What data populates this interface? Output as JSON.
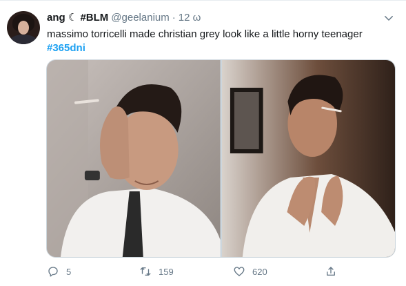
{
  "tweet": {
    "author": {
      "display_name": "ang ☾ #BLM",
      "handle": "@geelanium",
      "separator": "·",
      "time": "12 ω"
    },
    "text": "massimo torricelli made christian grey look like a little horny teenager",
    "hashtag": "#365dni",
    "media": {
      "count": 2,
      "subjects": [
        "man-smoking-hand-on-face",
        "man-unbuttoning-shirt-smoking"
      ]
    },
    "actions": {
      "reply_count": "5",
      "retweet_count": "159",
      "like_count": "620"
    }
  },
  "icons": {
    "more": "chevron-down-icon",
    "reply": "reply-icon",
    "retweet": "retweet-icon",
    "like": "heart-icon",
    "share": "share-icon"
  },
  "colors": {
    "accent": "#1da1f2",
    "secondary_text": "#657786",
    "border": "#ccd6dd"
  }
}
